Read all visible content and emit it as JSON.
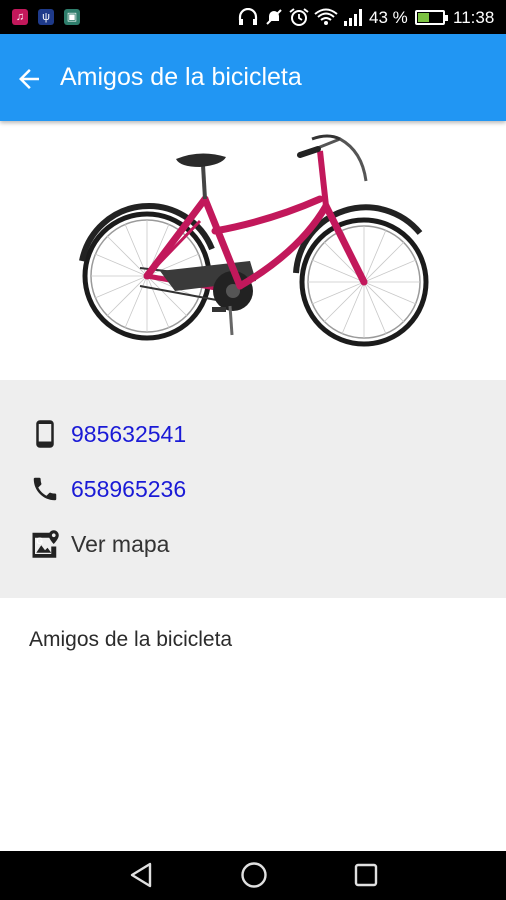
{
  "status_bar": {
    "battery_pct": "43 %",
    "battery_level": 0.43,
    "time": "11:38",
    "icons": [
      "music-app-icon",
      "usb-icon",
      "gallery-icon",
      "headphones-icon",
      "mute-icon",
      "alarm-icon",
      "wifi-icon",
      "signal-icon",
      "battery-icon"
    ]
  },
  "app_bar": {
    "back_icon": "arrow-back-icon",
    "title": "Amigos de la bicicleta",
    "color": "#2196f3"
  },
  "hero": {
    "image": "pink-city-bicycle",
    "frame_color": "#c2185b"
  },
  "contact": {
    "mobile": {
      "icon": "smartphone-icon",
      "value": "985632541"
    },
    "phone": {
      "icon": "phone-icon",
      "value": "658965236"
    },
    "map": {
      "icon": "map-icon",
      "label": "Ver mapa"
    },
    "link_color": "#1a1ad6"
  },
  "description": "Amigos de la bicicleta",
  "nav_bar": {
    "buttons": [
      "back-triangle-icon",
      "home-circle-icon",
      "recents-square-icon"
    ]
  }
}
